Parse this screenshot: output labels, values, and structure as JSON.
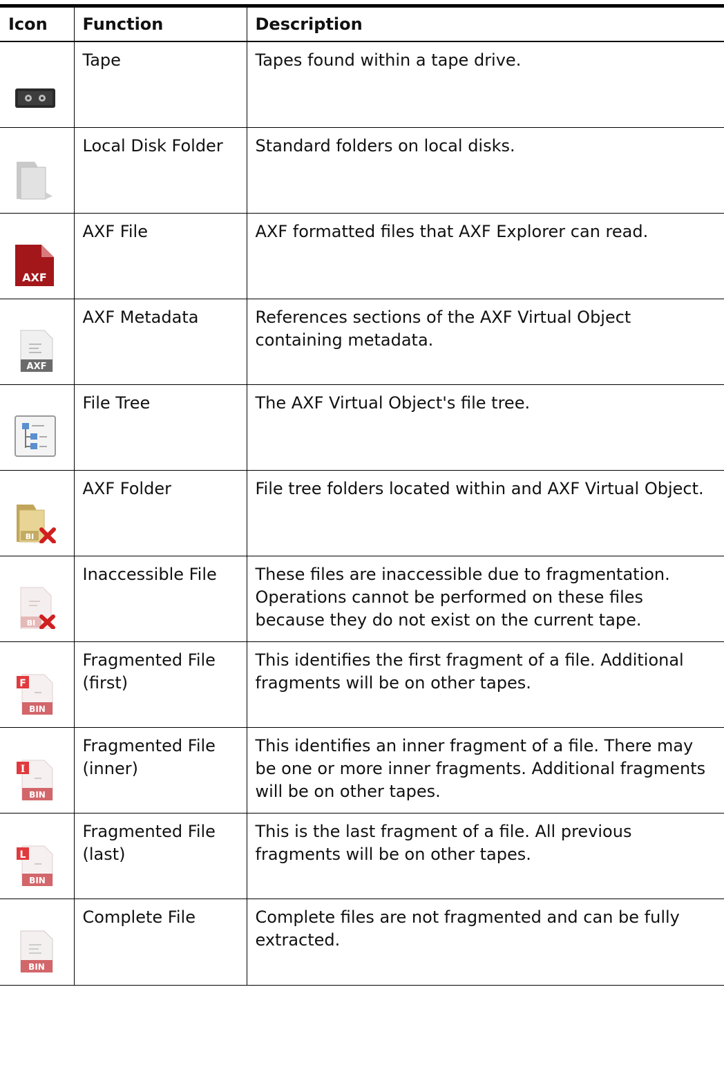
{
  "table": {
    "headers": [
      "Icon",
      "Function",
      "Description"
    ],
    "rows": [
      {
        "icon": "tape-icon",
        "function": "Tape",
        "description": "Tapes found within a tape drive."
      },
      {
        "icon": "local-disk-folder-icon",
        "function": "Local Disk Folder",
        "description": "Standard folders on local disks."
      },
      {
        "icon": "axf-file-icon",
        "function": "AXF File",
        "description": "AXF formatted files that AXF Explorer can read."
      },
      {
        "icon": "axf-metadata-icon",
        "function": "AXF Metadata",
        "description": "References sections of the AXF Virtual Object containing metadata."
      },
      {
        "icon": "file-tree-icon",
        "function": "File Tree",
        "description": "The AXF Virtual Object's file tree."
      },
      {
        "icon": "axf-folder-icon",
        "function": "AXF Folder",
        "description": "File tree folders located within and AXF Virtual Object."
      },
      {
        "icon": "inaccessible-file-icon",
        "function": "Inaccessible File",
        "description": "These files are inaccessible due to fragmentation. Operations cannot be performed on these files because they do not exist on the current tape."
      },
      {
        "icon": "fragmented-first-icon",
        "function": "Fragmented File (first)",
        "description": "This identifies the first fragment of a file. Additional fragments will be on other tapes."
      },
      {
        "icon": "fragmented-inner-icon",
        "function": "Fragmented File (inner)",
        "description": "This identifies an inner fragment of a file. There may be one or more inner fragments. Additional fragments will be on other tapes."
      },
      {
        "icon": "fragmented-last-icon",
        "function": "Fragmented File (last)",
        "description": "This is the last fragment of a file. All previous fragments will be on other tapes."
      },
      {
        "icon": "complete-file-icon",
        "function": "Complete File",
        "description": "Complete files are not fragmented and can be fully extracted."
      }
    ]
  },
  "icon_text": {
    "axf": "AXF",
    "bin": "BIN",
    "first": "F",
    "inner": "I",
    "last": "L"
  },
  "colors": {
    "border": "#000000",
    "axf_red": "#a3161a",
    "fragment_red": "#e03a3e",
    "folder_tan": "#d9c27a",
    "x_red": "#d01f1f"
  }
}
